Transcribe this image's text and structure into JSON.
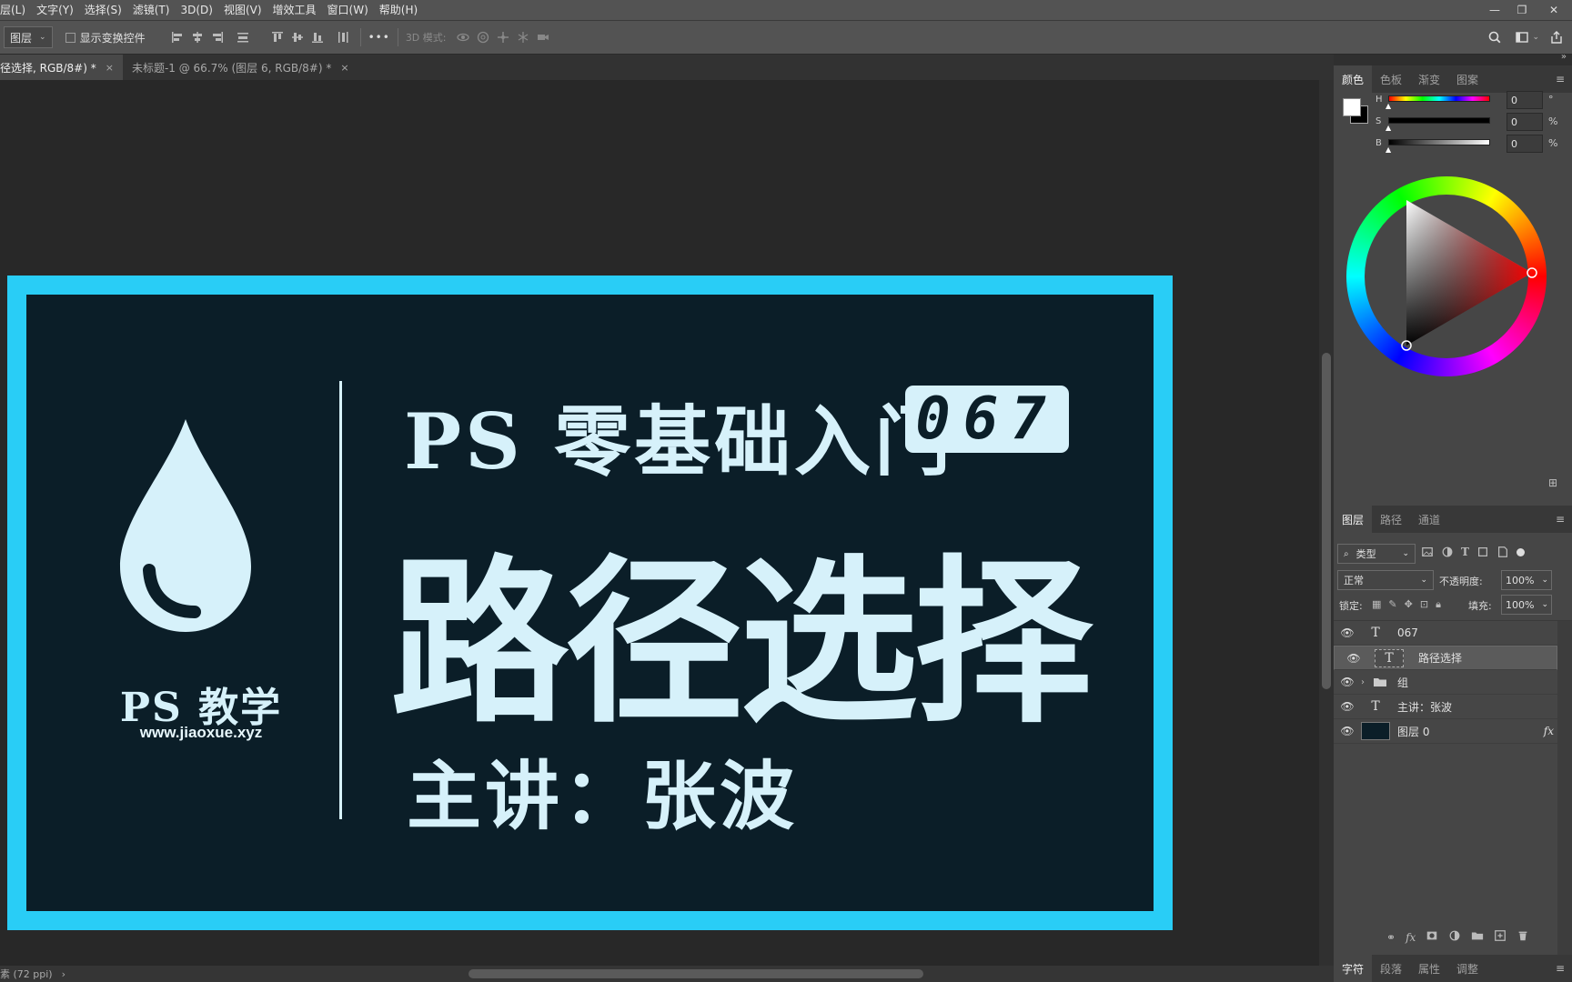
{
  "menubar": {
    "items": [
      "层(L)",
      "文字(Y)",
      "选择(S)",
      "滤镜(T)",
      "3D(D)",
      "视图(V)",
      "增效工具",
      "窗口(W)",
      "帮助(H)"
    ]
  },
  "window_controls": {
    "minimize": "—",
    "restore": "❐",
    "close": "✕"
  },
  "options": {
    "target_select": "图层",
    "show_transform": "显示变换控件",
    "more": "•••",
    "mode3d": "3D 模式:"
  },
  "tabs": [
    {
      "label": "径选择, RGB/8#) *",
      "close": "×"
    },
    {
      "label": "未标题-1 @ 66.7% (图层 6, RGB/8#) *",
      "close": "×"
    }
  ],
  "artwork": {
    "brand": "PS 教学",
    "site": "www.jiaoxue.xyz",
    "series": "PS 零基础入门",
    "episode": "067",
    "title": "路径选择",
    "presenter": "主讲：张波",
    "colors": {
      "frame": "#29cdf6",
      "background": "#0b1e28",
      "text": "#d6f1fa"
    }
  },
  "status": {
    "text": "素 (72 ppi)",
    "arrow": "›"
  },
  "color_panel": {
    "tabs": [
      "颜色",
      "色板",
      "渐变",
      "图案"
    ],
    "sliders": [
      {
        "label": "H",
        "value": "0",
        "unit": "°"
      },
      {
        "label": "S",
        "value": "0",
        "unit": "%"
      },
      {
        "label": "B",
        "value": "0",
        "unit": "%"
      }
    ]
  },
  "layers_panel": {
    "tabs": [
      "图层",
      "路径",
      "通道"
    ],
    "filter_type": "类型",
    "blend_mode": "正常",
    "opacity_label": "不透明度:",
    "opacity_value": "100%",
    "lock_label": "锁定:",
    "fill_label": "填充:",
    "fill_value": "100%",
    "layers": [
      {
        "name": "067",
        "kind": "text"
      },
      {
        "name": "路径选择",
        "kind": "text",
        "selected": true
      },
      {
        "name": "组",
        "kind": "group"
      },
      {
        "name": "主讲：张波",
        "kind": "text"
      },
      {
        "name": "图层 0",
        "kind": "pixel",
        "fx": "fx"
      }
    ]
  },
  "bottom_panel": {
    "tabs": [
      "字符",
      "段落",
      "属性",
      "调整"
    ]
  }
}
